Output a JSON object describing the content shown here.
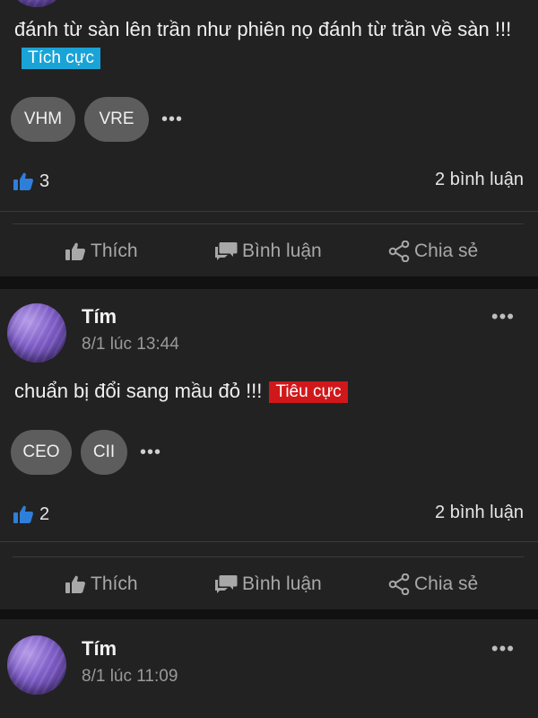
{
  "colors": {
    "positive": "#1aa3d6",
    "negative": "#d0181b",
    "like_icon": "#2e7fd9"
  },
  "post_top": {
    "text": "đánh từ sàn lên trần như phiên nọ đánh từ trần về sàn !!!",
    "sentiment": "Tích cực",
    "tags": [
      "VHM",
      "VRE"
    ],
    "likes": "3",
    "comments": "2 bình luận"
  },
  "post_mid": {
    "author": "Tím",
    "time": "8/1 lúc 13:44",
    "text": "chuẩn bị đổi sang mầu đỏ !!!",
    "sentiment": "Tiêu cực",
    "tags": [
      "CEO",
      "CII"
    ],
    "likes": "2",
    "comments": "2 bình luận"
  },
  "post_bottom": {
    "author": "Tím",
    "time": "8/1 lúc 11:09"
  },
  "actions": {
    "like": "Thích",
    "comment": "Bình luận",
    "share": "Chia sẻ"
  },
  "more_glyph": "•••",
  "icons": [
    "thumbs-up-icon",
    "comment-icon",
    "share-icon",
    "more-icon"
  ]
}
